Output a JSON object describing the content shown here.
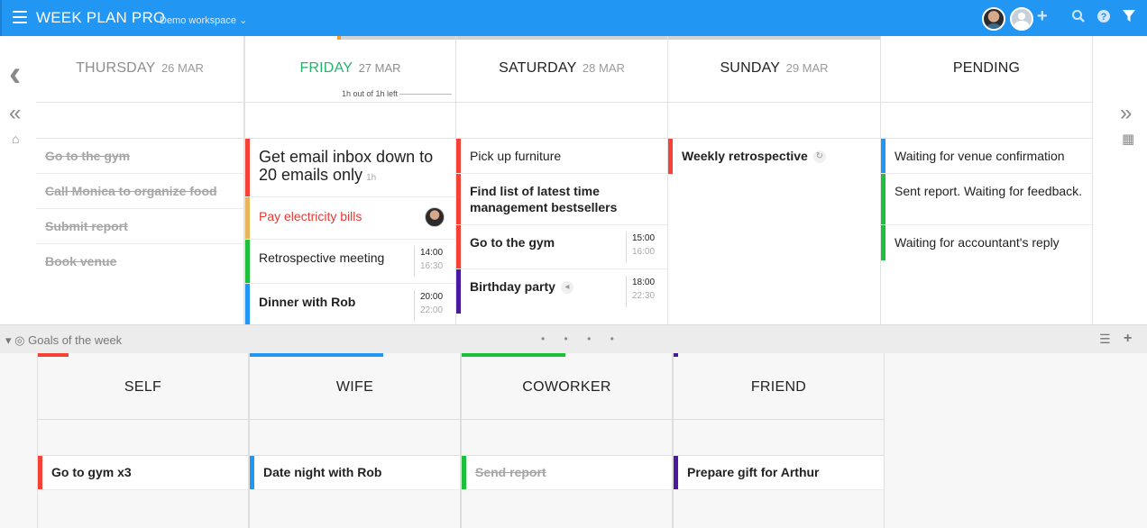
{
  "header": {
    "title": "WEEK PLAN PRO",
    "workspace": "Demo workspace",
    "workspace_caret": "⌄",
    "icons": [
      "menu-icon",
      "user-avatar",
      "empty-avatar",
      "plus-icon",
      "search-icon",
      "help-icon",
      "filter-icon"
    ],
    "plus_glyph": "+",
    "search_glyph": "⚲",
    "help_glyph": "?",
    "filter_glyph": "▼"
  },
  "week_progress": {
    "fraction": 0.007,
    "fill_color": "#f0a020"
  },
  "nav": {
    "prev_glyph": "‹",
    "prev_week_glyph": "«",
    "home_glyph": "⌂",
    "next_week_glyph": "»",
    "calendar_glyph": "▦"
  },
  "days": [
    {
      "name": "THURSDAY",
      "date": "26 MAR",
      "tasks": [
        {
          "text": "Go to the gym",
          "done": true
        },
        {
          "text": "Call Monica to organize food",
          "done": true
        },
        {
          "text": "Submit report",
          "done": true
        },
        {
          "text": "Book venue",
          "done": true
        }
      ]
    },
    {
      "name": "FRIDAY",
      "date": "27 MAR",
      "time_left": "1h out of 1h left",
      "tasks": [
        {
          "text": "Get email inbox down to 20 emails only",
          "estimate": "1h",
          "color": "#f44336"
        },
        {
          "text": "Pay electricity bills",
          "color": "#e8b55a",
          "text_color": "#e53935"
        },
        {
          "text": "Retrospective meeting",
          "start": "14:00",
          "end": "16:30",
          "color": "#1fbf3a"
        },
        {
          "text": "Dinner with Rob",
          "start": "20:00",
          "end": "22:00",
          "color": "#2196f3",
          "bold": true
        }
      ]
    },
    {
      "name": "SATURDAY",
      "date": "28 MAR",
      "tasks": [
        {
          "text": "Pick up furniture",
          "color": "#f44336"
        },
        {
          "text": "Find list of latest time management bestsellers",
          "color": "#f44336",
          "bold": true
        },
        {
          "text": "Go to the gym",
          "start": "15:00",
          "end": "16:00",
          "color": "#f44336",
          "bold": true
        },
        {
          "text": "Birthday party",
          "start": "18:00",
          "end": "22:30",
          "color": "#4b1a9c",
          "bold": true,
          "icon": "megaphone-icon",
          "icon_glyph": "◂"
        }
      ]
    },
    {
      "name": "SUNDAY",
      "date": "29 MAR",
      "tasks": [
        {
          "text": "Weekly retrospective",
          "color": "#f44336",
          "bold": true,
          "icon": "repeat-icon",
          "icon_glyph": "↻"
        }
      ]
    }
  ],
  "pending": {
    "title": "PENDING",
    "tasks": [
      {
        "text": "Waiting for venue confirmation",
        "color": "#2196f3"
      },
      {
        "text": "Sent report. Waiting for feedback.",
        "color": "#1fbf3a"
      },
      {
        "text": "Waiting for accountant's reply",
        "color": "#1fbf3a"
      }
    ]
  },
  "goals": {
    "label": "Goals of the week",
    "caret": "▾",
    "target_glyph": "◎",
    "dots": "• • • •",
    "list_glyph": "☰",
    "add_glyph": "+",
    "columns": [
      {
        "name": "SELF",
        "accent": "#f44336",
        "accent_fraction": 0.14,
        "task": "Go to gym x3",
        "color": "#f44336",
        "done": false
      },
      {
        "name": "WIFE",
        "accent": "#2196f3",
        "accent_fraction": 0.63,
        "task": "Date night with Rob",
        "color": "#2196f3",
        "done": false
      },
      {
        "name": "COWORKER",
        "accent": "#1fbf3a",
        "accent_fraction": 0.49,
        "task": "Send report",
        "color": "#1fbf3a",
        "done": true
      },
      {
        "name": "FRIEND",
        "accent": "#4b1a9c",
        "accent_fraction": 0.02,
        "task": "Prepare gift for Arthur",
        "color": "#4b1a9c",
        "done": false
      }
    ]
  }
}
